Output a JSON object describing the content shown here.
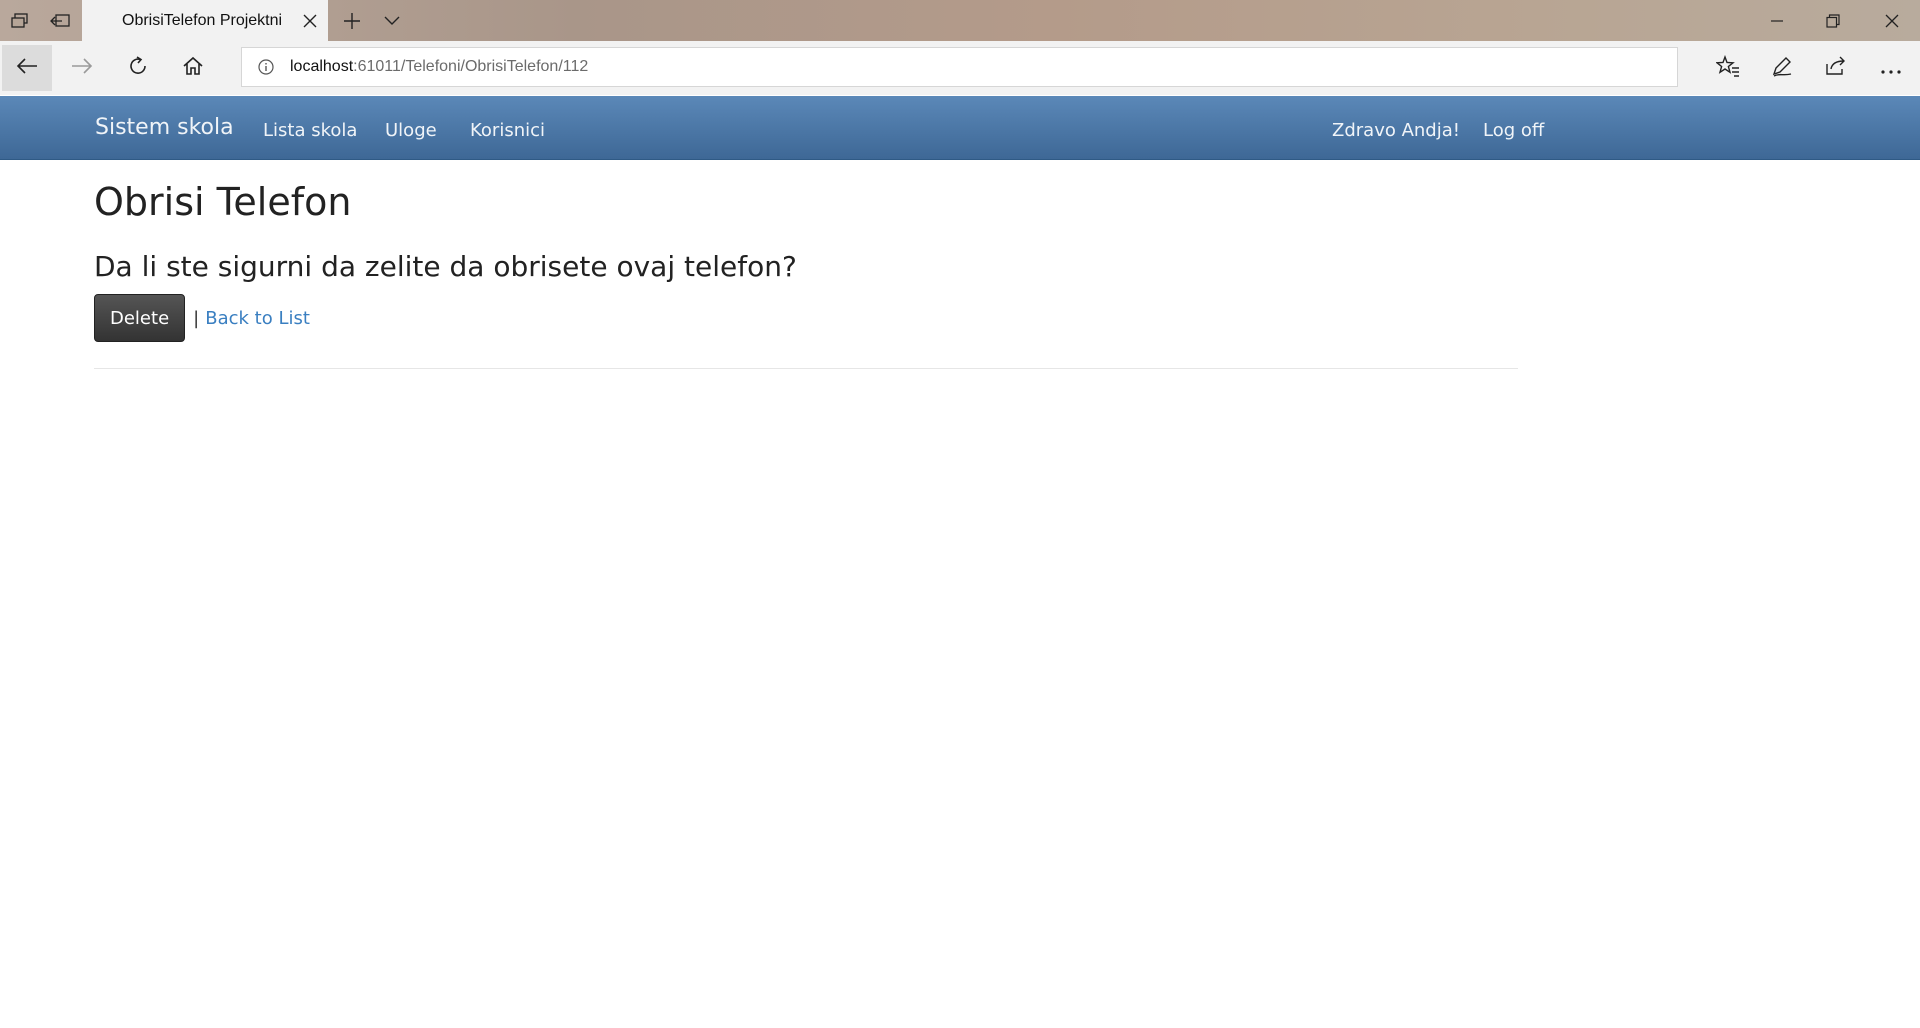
{
  "browser": {
    "tab_title": "ObrisiTelefon Projektni",
    "url_host": "localhost",
    "url_rest": ":61011/Telefoni/ObrisiTelefon/112"
  },
  "navbar": {
    "brand": "Sistem skola",
    "links": [
      "Lista skola",
      "Uloge",
      "Korisnici"
    ],
    "greeting": "Zdravo Andja!",
    "logoff": "Log off",
    "bg_color": "#4a76a6"
  },
  "main": {
    "title": "Obrisi Telefon",
    "question": "Da li ste sigurni da zelite da obrisete ovaj telefon?",
    "delete_label": "Delete",
    "separator": "|",
    "back_label": "Back to List",
    "link_color": "#3a7fc1"
  },
  "icons": {
    "tab_actions": [
      "tab-overview-icon",
      "set-aside-tabs-icon"
    ],
    "tab_strip": [
      "close-tab-icon",
      "new-tab-icon",
      "tab-preview-chevron-icon"
    ],
    "window": [
      "minimize-icon",
      "restore-icon",
      "close-window-icon"
    ],
    "toolbar": [
      "back-icon",
      "forward-icon",
      "refresh-icon",
      "home-icon",
      "site-info-icon",
      "favorites-icon",
      "pen-icon",
      "share-icon",
      "more-icon"
    ]
  }
}
